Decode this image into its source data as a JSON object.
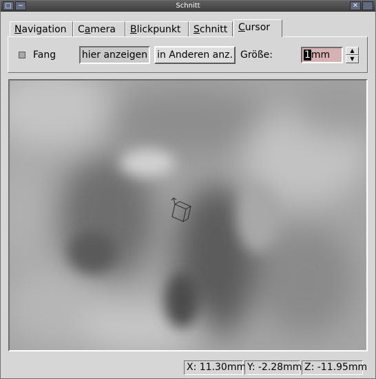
{
  "window": {
    "title": "Schnitt"
  },
  "tabs": [
    {
      "label": "Navigation",
      "mnemonic": "N",
      "rest": "avigation"
    },
    {
      "label": "Camera",
      "pre": "C",
      "mnemonic": "a",
      "rest": "mera"
    },
    {
      "label": "Blickpunkt",
      "mnemonic": "B",
      "rest": "lickpunkt"
    },
    {
      "label": "Schnitt",
      "mnemonic": "S",
      "rest": "chnitt"
    },
    {
      "label": "Cursor",
      "mnemonic": "C",
      "rest": "ursor",
      "active": true
    }
  ],
  "controls": {
    "fang_label": "Fang",
    "fang_checked": false,
    "show_here_label": "hier anzeigen",
    "show_here_pressed": true,
    "show_others_label": "in Anderen anz.",
    "size_label": "Größe:",
    "size_value": "1",
    "size_unit": "mm"
  },
  "status": {
    "x": "X: 11.30mm",
    "y": "Y: -2.28mm",
    "z": "Z: -11.95mm"
  },
  "colors": {
    "size_field_bg": "#d8b2b2",
    "window_bg": "#d6d6d6"
  }
}
